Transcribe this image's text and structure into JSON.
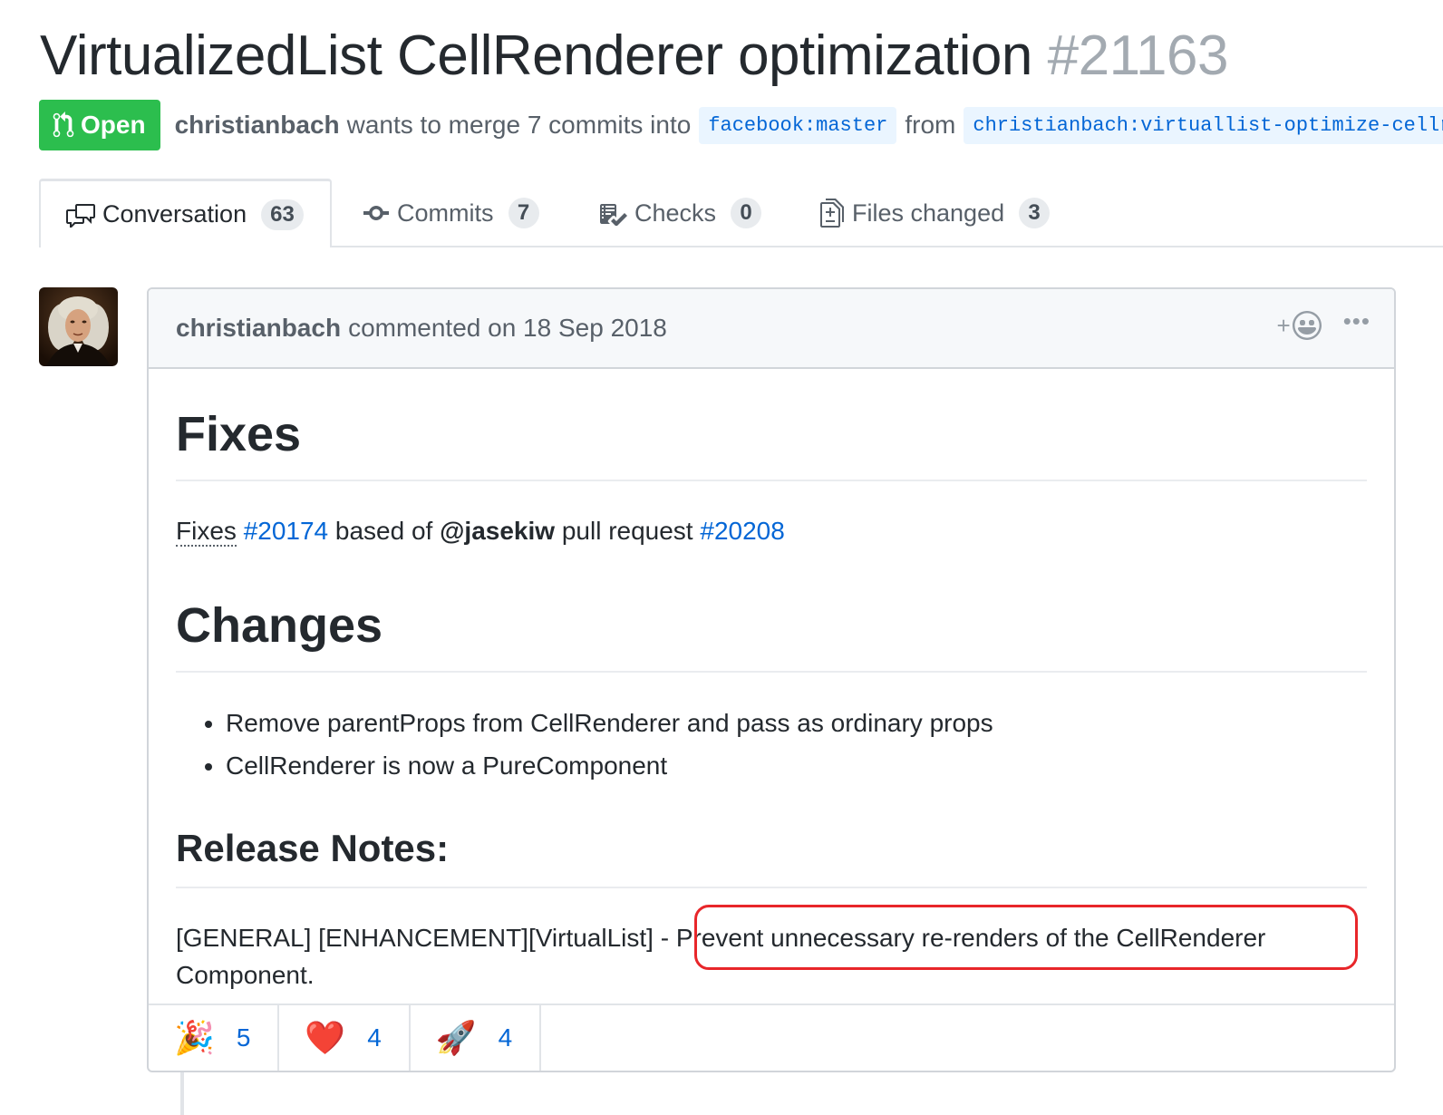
{
  "pr": {
    "title": "VirtualizedList CellRenderer optimization",
    "number": "#21163",
    "state": "Open",
    "author": "christianbach",
    "merge_text": "wants to merge 7 commits into",
    "base_branch": "facebook:master",
    "from_text": "from",
    "head_branch": "christianbach:virtuallist-optimize-cellr"
  },
  "tabs": [
    {
      "label": "Conversation",
      "count": "63",
      "icon": "comment-discussion-icon"
    },
    {
      "label": "Commits",
      "count": "7",
      "icon": "git-commit-icon"
    },
    {
      "label": "Checks",
      "count": "0",
      "icon": "checklist-icon"
    },
    {
      "label": "Files changed",
      "count": "3",
      "icon": "file-diff-icon"
    }
  ],
  "comment": {
    "author": "christianbach",
    "meta": "commented on 18 Sep 2018",
    "fixes_heading": "Fixes",
    "fixes_line": {
      "word": "Fixes",
      "issue": "#20174",
      "mid": "based of",
      "mention": "@jasekiw",
      "mid2": "pull request",
      "pr": "#20208"
    },
    "changes_heading": "Changes",
    "changes": [
      "Remove parentProps from CellRenderer and pass as ordinary props",
      "CellRenderer is now a PureComponent"
    ],
    "release_heading": "Release Notes:",
    "release_text": "[GENERAL] [ENHANCEMENT][VirtualList] - Prevent unnecessary re-renders of the CellRenderer Component."
  },
  "reactions": [
    {
      "emoji": "🎉",
      "name": "tada",
      "count": "5"
    },
    {
      "emoji": "❤️",
      "name": "heart",
      "count": "4"
    },
    {
      "emoji": "🚀",
      "name": "rocket",
      "count": "4"
    }
  ],
  "colors": {
    "open_green": "#2cbe4e",
    "link_blue": "#0366d6",
    "highlight_red": "#e8262a"
  }
}
